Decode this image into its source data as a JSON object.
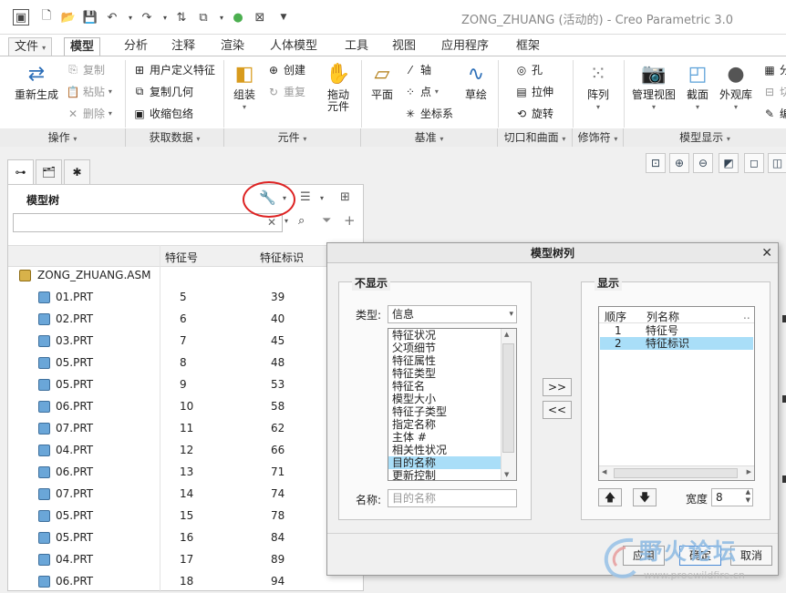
{
  "window": {
    "title": "ZONG_ZHUANG (活动的) - Creo Parametric 3.0"
  },
  "menu_tabs": [
    "文件",
    "模型",
    "分析",
    "注释",
    "渲染",
    "人体模型",
    "工具",
    "视图",
    "应用程序",
    "框架"
  ],
  "ribbon": {
    "regenerate": "重新生成",
    "copy": "复制",
    "paste": "粘贴",
    "delete": "删除",
    "udf": "用户定义特征",
    "copy_geom": "复制几何",
    "shrinkwrap": "收缩包络",
    "assemble": "组装",
    "create": "创建",
    "repeat": "重复",
    "drag_l1": "拖动",
    "drag_l2": "元件",
    "plane": "平面",
    "axis": "轴",
    "point": "点",
    "coord": "坐标系",
    "sketch": "草绘",
    "hole": "孔",
    "extrude": "拉伸",
    "revolve": "旋转",
    "pattern": "阵列",
    "manage_views": "管理视图",
    "section": "截面",
    "appearance": "外观库",
    "cut1": "分",
    "cut2": "切",
    "cut3": "编",
    "groups": [
      "操作",
      "获取数据",
      "元件",
      "基准",
      "切口和曲面",
      "修饰符",
      "模型显示"
    ]
  },
  "model_tree": {
    "title": "模型树",
    "col_feature_no": "特征号",
    "col_feature_id": "特征标识",
    "root": "ZONG_ZHUANG.ASM",
    "rows": [
      {
        "name": "01.PRT",
        "no": "5",
        "id": "39"
      },
      {
        "name": "02.PRT",
        "no": "6",
        "id": "40"
      },
      {
        "name": "03.PRT",
        "no": "7",
        "id": "45"
      },
      {
        "name": "05.PRT",
        "no": "8",
        "id": "48"
      },
      {
        "name": "05.PRT",
        "no": "9",
        "id": "53"
      },
      {
        "name": "06.PRT",
        "no": "10",
        "id": "58"
      },
      {
        "name": "07.PRT",
        "no": "11",
        "id": "62"
      },
      {
        "name": "04.PRT",
        "no": "12",
        "id": "66"
      },
      {
        "name": "06.PRT",
        "no": "13",
        "id": "71"
      },
      {
        "name": "07.PRT",
        "no": "14",
        "id": "74"
      },
      {
        "name": "05.PRT",
        "no": "15",
        "id": "78"
      },
      {
        "name": "05.PRT",
        "no": "16",
        "id": "84"
      },
      {
        "name": "04.PRT",
        "no": "17",
        "id": "89"
      },
      {
        "name": "06.PRT",
        "no": "18",
        "id": "94"
      }
    ]
  },
  "dialog": {
    "title": "模型树列",
    "not_shown": "不显示",
    "shown": "显示",
    "type_label": "类型:",
    "type_value": "信息",
    "available": [
      "特征状况",
      "父项细节",
      "特征属性",
      "特征类型",
      "特征名",
      "模型大小",
      "特征子类型",
      "指定名称",
      "主体 #",
      "相关性状况",
      "目的名称",
      "更新控制"
    ],
    "selected_item": "目的名称",
    "add_btn": ">>",
    "remove_btn": "<<",
    "name_label": "名称:",
    "name_placeholder": "目的名称",
    "col_order": "顺序",
    "col_name": "列名称",
    "col_more": "..",
    "displayed": [
      {
        "order": "1",
        "name": "特征号"
      },
      {
        "order": "2",
        "name": "特征标识"
      }
    ],
    "width_label": "宽度",
    "width_value": "8",
    "apply": "应用",
    "ok": "确定",
    "cancel": "取消"
  },
  "watermark": {
    "text": "野火论坛",
    "url": "www.proewildfire.cn"
  }
}
